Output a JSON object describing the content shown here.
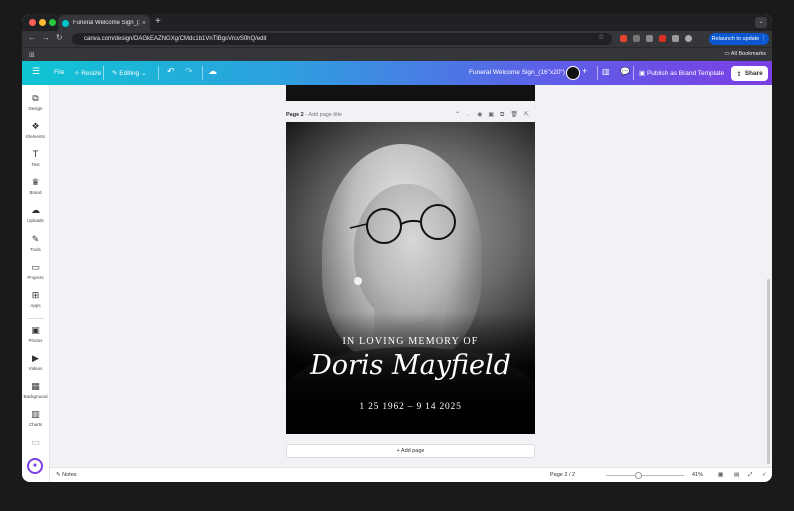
{
  "browser": {
    "tab_title": "Funeral Welcome Sign_(16\"x20\")",
    "tab_close": "×",
    "new_tab": "+",
    "url": "canva.com/design/DAGkEAZNGXg/CMdc1b1VnTlBgsVrcvS0hQ/edit",
    "relaunch": "Relaunch to update  ⋮",
    "bookmarks": "All Bookmarks"
  },
  "toolbar": {
    "menu_icon": "☰",
    "file": "File",
    "resize": "Resize",
    "editing": "Editing",
    "doc_title": "Funeral Welcome Sign_(16\"x20\")",
    "publish": "Publish as Brand Template",
    "share": "Share"
  },
  "sidebar": {
    "items": [
      {
        "label": "Design",
        "icon": "⧉"
      },
      {
        "label": "Elements",
        "icon": "❖"
      },
      {
        "label": "Text",
        "icon": "T"
      },
      {
        "label": "Brand",
        "icon": "♛"
      },
      {
        "label": "Uploads",
        "icon": "☁"
      },
      {
        "label": "Tools",
        "icon": "✎"
      },
      {
        "label": "Projects",
        "icon": "▭"
      },
      {
        "label": "Apps",
        "icon": "⊞"
      },
      {
        "label": "Photos",
        "icon": "▣"
      },
      {
        "label": "Videos",
        "icon": "▶"
      },
      {
        "label": "Background",
        "icon": "▦"
      },
      {
        "label": "Charts",
        "icon": "▥"
      }
    ]
  },
  "page2": {
    "title": "Page 2",
    "add_title": " - Add page title"
  },
  "design": {
    "memory_line": "IN LOVING MEMORY OF",
    "name": "Doris Mayfield",
    "dates": "1 25 1962 – 9 14 2025"
  },
  "add_page": "+ Add page",
  "footer": {
    "notes": "Notes",
    "page_counter": "Page 2 / 2",
    "zoom": "41%"
  },
  "colors": {
    "brand_gradient_start": "#0fc4d3",
    "brand_gradient_end": "#7b3fe4",
    "relaunch": "#0b57d0"
  }
}
